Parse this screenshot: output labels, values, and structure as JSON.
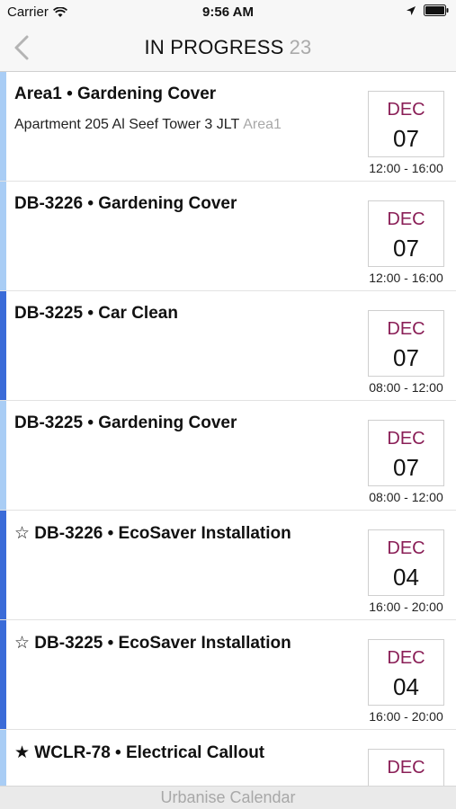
{
  "status_bar": {
    "carrier": "Carrier",
    "time": "9:56 AM"
  },
  "nav": {
    "title": "IN PROGRESS",
    "count": "23"
  },
  "colors": {
    "light_stripe": "#a9cdf5",
    "dark_stripe": "#3a6bd8",
    "month": "#8a1f57"
  },
  "jobs": [
    {
      "title": "Area1 • Gardening Cover",
      "address": "Apartment 205 Al Seef Tower 3 JLT",
      "area": "Area1",
      "month": "DEC",
      "day": "07",
      "time": "12:00 - 16:00",
      "stripe": "light"
    },
    {
      "title": "DB-3226 • Gardening Cover",
      "address": "",
      "area": "",
      "month": "DEC",
      "day": "07",
      "time": "12:00 - 16:00",
      "stripe": "light"
    },
    {
      "title": "DB-3225 • Car Clean",
      "address": "",
      "area": "",
      "month": "DEC",
      "day": "07",
      "time": "08:00 - 12:00",
      "stripe": "dark"
    },
    {
      "title": "DB-3225 • Gardening Cover",
      "address": "",
      "area": "",
      "month": "DEC",
      "day": "07",
      "time": "08:00 - 12:00",
      "stripe": "light"
    },
    {
      "title": "☆ DB-3226 • EcoSaver Installation",
      "address": "",
      "area": "",
      "month": "DEC",
      "day": "04",
      "time": "16:00 - 20:00",
      "stripe": "dark"
    },
    {
      "title": "☆ DB-3225 • EcoSaver Installation",
      "address": "",
      "area": "",
      "month": "DEC",
      "day": "04",
      "time": "16:00 - 20:00",
      "stripe": "dark"
    },
    {
      "title": "★ WCLR-78 • Electrical Callout",
      "address": "",
      "area": "",
      "month": "DEC",
      "day": "",
      "time": "",
      "stripe": "light"
    }
  ],
  "footer": {
    "label": "Urbanise Calendar"
  }
}
